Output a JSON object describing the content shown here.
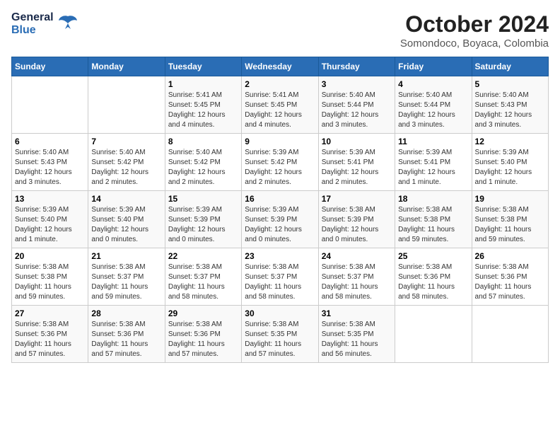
{
  "logo": {
    "line1": "General",
    "line2": "Blue"
  },
  "header": {
    "month": "October 2024",
    "location": "Somondoco, Boyaca, Colombia"
  },
  "days_of_week": [
    "Sunday",
    "Monday",
    "Tuesday",
    "Wednesday",
    "Thursday",
    "Friday",
    "Saturday"
  ],
  "weeks": [
    [
      {
        "day": "",
        "info": ""
      },
      {
        "day": "",
        "info": ""
      },
      {
        "day": "1",
        "info": "Sunrise: 5:41 AM\nSunset: 5:45 PM\nDaylight: 12 hours\nand 4 minutes."
      },
      {
        "day": "2",
        "info": "Sunrise: 5:41 AM\nSunset: 5:45 PM\nDaylight: 12 hours\nand 4 minutes."
      },
      {
        "day": "3",
        "info": "Sunrise: 5:40 AM\nSunset: 5:44 PM\nDaylight: 12 hours\nand 3 minutes."
      },
      {
        "day": "4",
        "info": "Sunrise: 5:40 AM\nSunset: 5:44 PM\nDaylight: 12 hours\nand 3 minutes."
      },
      {
        "day": "5",
        "info": "Sunrise: 5:40 AM\nSunset: 5:43 PM\nDaylight: 12 hours\nand 3 minutes."
      }
    ],
    [
      {
        "day": "6",
        "info": "Sunrise: 5:40 AM\nSunset: 5:43 PM\nDaylight: 12 hours\nand 3 minutes."
      },
      {
        "day": "7",
        "info": "Sunrise: 5:40 AM\nSunset: 5:42 PM\nDaylight: 12 hours\nand 2 minutes."
      },
      {
        "day": "8",
        "info": "Sunrise: 5:40 AM\nSunset: 5:42 PM\nDaylight: 12 hours\nand 2 minutes."
      },
      {
        "day": "9",
        "info": "Sunrise: 5:39 AM\nSunset: 5:42 PM\nDaylight: 12 hours\nand 2 minutes."
      },
      {
        "day": "10",
        "info": "Sunrise: 5:39 AM\nSunset: 5:41 PM\nDaylight: 12 hours\nand 2 minutes."
      },
      {
        "day": "11",
        "info": "Sunrise: 5:39 AM\nSunset: 5:41 PM\nDaylight: 12 hours\nand 1 minute."
      },
      {
        "day": "12",
        "info": "Sunrise: 5:39 AM\nSunset: 5:40 PM\nDaylight: 12 hours\nand 1 minute."
      }
    ],
    [
      {
        "day": "13",
        "info": "Sunrise: 5:39 AM\nSunset: 5:40 PM\nDaylight: 12 hours\nand 1 minute."
      },
      {
        "day": "14",
        "info": "Sunrise: 5:39 AM\nSunset: 5:40 PM\nDaylight: 12 hours\nand 0 minutes."
      },
      {
        "day": "15",
        "info": "Sunrise: 5:39 AM\nSunset: 5:39 PM\nDaylight: 12 hours\nand 0 minutes."
      },
      {
        "day": "16",
        "info": "Sunrise: 5:39 AM\nSunset: 5:39 PM\nDaylight: 12 hours\nand 0 minutes."
      },
      {
        "day": "17",
        "info": "Sunrise: 5:38 AM\nSunset: 5:39 PM\nDaylight: 12 hours\nand 0 minutes."
      },
      {
        "day": "18",
        "info": "Sunrise: 5:38 AM\nSunset: 5:38 PM\nDaylight: 11 hours\nand 59 minutes."
      },
      {
        "day": "19",
        "info": "Sunrise: 5:38 AM\nSunset: 5:38 PM\nDaylight: 11 hours\nand 59 minutes."
      }
    ],
    [
      {
        "day": "20",
        "info": "Sunrise: 5:38 AM\nSunset: 5:38 PM\nDaylight: 11 hours\nand 59 minutes."
      },
      {
        "day": "21",
        "info": "Sunrise: 5:38 AM\nSunset: 5:37 PM\nDaylight: 11 hours\nand 59 minutes."
      },
      {
        "day": "22",
        "info": "Sunrise: 5:38 AM\nSunset: 5:37 PM\nDaylight: 11 hours\nand 58 minutes."
      },
      {
        "day": "23",
        "info": "Sunrise: 5:38 AM\nSunset: 5:37 PM\nDaylight: 11 hours\nand 58 minutes."
      },
      {
        "day": "24",
        "info": "Sunrise: 5:38 AM\nSunset: 5:37 PM\nDaylight: 11 hours\nand 58 minutes."
      },
      {
        "day": "25",
        "info": "Sunrise: 5:38 AM\nSunset: 5:36 PM\nDaylight: 11 hours\nand 58 minutes."
      },
      {
        "day": "26",
        "info": "Sunrise: 5:38 AM\nSunset: 5:36 PM\nDaylight: 11 hours\nand 57 minutes."
      }
    ],
    [
      {
        "day": "27",
        "info": "Sunrise: 5:38 AM\nSunset: 5:36 PM\nDaylight: 11 hours\nand 57 minutes."
      },
      {
        "day": "28",
        "info": "Sunrise: 5:38 AM\nSunset: 5:36 PM\nDaylight: 11 hours\nand 57 minutes."
      },
      {
        "day": "29",
        "info": "Sunrise: 5:38 AM\nSunset: 5:36 PM\nDaylight: 11 hours\nand 57 minutes."
      },
      {
        "day": "30",
        "info": "Sunrise: 5:38 AM\nSunset: 5:35 PM\nDaylight: 11 hours\nand 57 minutes."
      },
      {
        "day": "31",
        "info": "Sunrise: 5:38 AM\nSunset: 5:35 PM\nDaylight: 11 hours\nand 56 minutes."
      },
      {
        "day": "",
        "info": ""
      },
      {
        "day": "",
        "info": ""
      }
    ]
  ]
}
